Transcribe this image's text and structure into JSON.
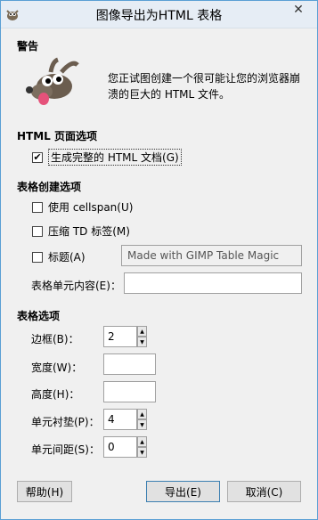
{
  "window": {
    "title": "图像导出为HTML 表格",
    "close_glyph": "✕"
  },
  "warning": {
    "heading": "警告",
    "icon": "gimp-mascot-icon",
    "text": "您正试图创建一个很可能让您的浏览器崩溃的巨大的 HTML 文件。"
  },
  "html_page_options": {
    "heading": "HTML 页面选项",
    "full_doc": {
      "label": "生成完整的 HTML 文档(G)",
      "checked": true
    }
  },
  "table_creation_options": {
    "heading": "表格创建选项",
    "cellspan": {
      "label": "使用 cellspan(U)",
      "checked": false
    },
    "compress_td": {
      "label": "压缩 TD 标签(M)",
      "checked": false
    },
    "caption": {
      "label": "标题(A)",
      "checked": false,
      "value": "Made with GIMP Table Magic"
    },
    "cell_content": {
      "label": "表格单元内容(E)：",
      "value": ""
    }
  },
  "table_options": {
    "heading": "表格选项",
    "border": {
      "label": "边框(B)：",
      "value": "2"
    },
    "width": {
      "label": "宽度(W)：",
      "value": ""
    },
    "height": {
      "label": "高度(H)：",
      "value": ""
    },
    "cellpadding": {
      "label": "单元衬垫(P)：",
      "value": "4"
    },
    "cellspacing": {
      "label": "单元间距(S)：",
      "value": "0"
    }
  },
  "buttons": {
    "help": "帮助(H)",
    "export": "导出(E)",
    "cancel": "取消(C)"
  },
  "glyphs": {
    "check": "✔",
    "up": "▲",
    "down": "▼"
  }
}
